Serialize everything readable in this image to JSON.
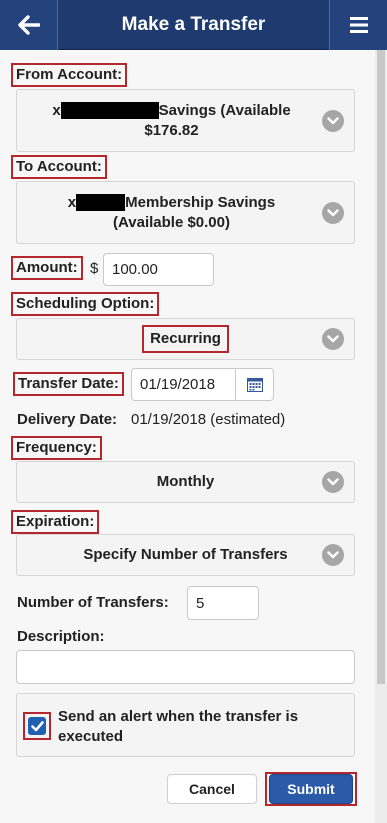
{
  "header": {
    "title": "Make a Transfer",
    "back_icon": "arrow-left-icon",
    "menu_icon": "hamburger-menu-icon"
  },
  "from_account": {
    "label": "From Account:",
    "prefix": "x",
    "name": "Savings (Available",
    "balance": "$176.82"
  },
  "to_account": {
    "label": "To Account:",
    "prefix": "x",
    "name": "Membership Savings",
    "balance": "(Available $0.00)"
  },
  "amount": {
    "label": "Amount:",
    "currency": "$",
    "value": "100.00"
  },
  "scheduling": {
    "label": "Scheduling Option:",
    "value": "Recurring"
  },
  "transfer_date": {
    "label": "Transfer Date:",
    "value": "01/19/2018",
    "icon": "calendar-icon"
  },
  "delivery_date": {
    "label": "Delivery Date:",
    "value": "01/19/2018 (estimated)"
  },
  "frequency": {
    "label": "Frequency:",
    "value": "Monthly"
  },
  "expiration": {
    "label": "Expiration:",
    "value": "Specify Number of Transfers"
  },
  "num_transfers": {
    "label": "Number of Transfers:",
    "value": "5"
  },
  "description": {
    "label": "Description:",
    "value": ""
  },
  "alert": {
    "checked": true,
    "line1": "Send an alert when the transfer is",
    "line2": "executed"
  },
  "buttons": {
    "cancel": "Cancel",
    "submit": "Submit"
  },
  "colors": {
    "header": "#1f3a6e",
    "highlight": "#b4282d",
    "submit": "#2a5aa8",
    "checkbox": "#1f5fb4"
  }
}
